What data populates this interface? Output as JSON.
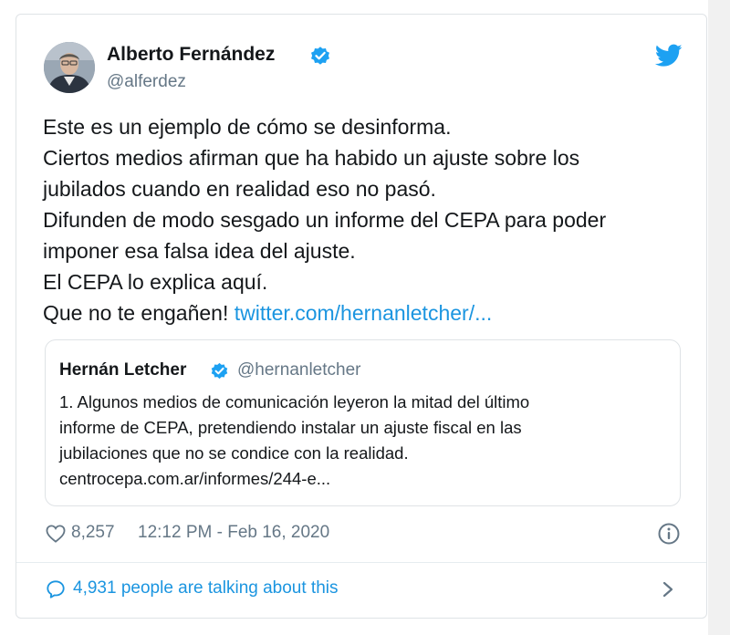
{
  "colors": {
    "accent": "#1b95e0",
    "text": "#14171a",
    "muted": "#657786",
    "border": "#dfe3e6"
  },
  "tweet": {
    "author_name": "Alberto Fernández",
    "author_handle": "@alferdez",
    "lines": [
      "Este es un ejemplo de cómo se desinforma.",
      "Ciertos medios afirman que ha habido un ajuste sobre los",
      "jubilados cuando en realidad eso no pasó.",
      "Difunden de modo sesgado un informe del CEPA para poder",
      "imponer esa falsa idea del ajuste.",
      "El CEPA lo explica aquí.",
      "Que no te engañen!"
    ],
    "link_text": "twitter.com/hernanletcher/..."
  },
  "quote": {
    "author_name": "Hernán Letcher",
    "author_handle": "@hernanletcher",
    "lines": [
      "1. Algunos medios de comunicación leyeron la mitad del último",
      "informe de CEPA, pretendiendo instalar un ajuste fiscal en las",
      "jubilaciones que no se condice con la realidad.",
      "centrocepa.com.ar/informes/244-e..."
    ]
  },
  "meta": {
    "likes": "8,257",
    "timestamp": "12:12 PM - Feb 16, 2020"
  },
  "footer": {
    "talking_text": "4,931 people are talking about this"
  },
  "icons": {
    "verified": "verified-icon",
    "twitter": "twitter-bird-icon",
    "heart": "heart-icon",
    "info": "info-icon",
    "chat": "chat-bubble-icon",
    "chevron": "chevron-right-icon"
  }
}
